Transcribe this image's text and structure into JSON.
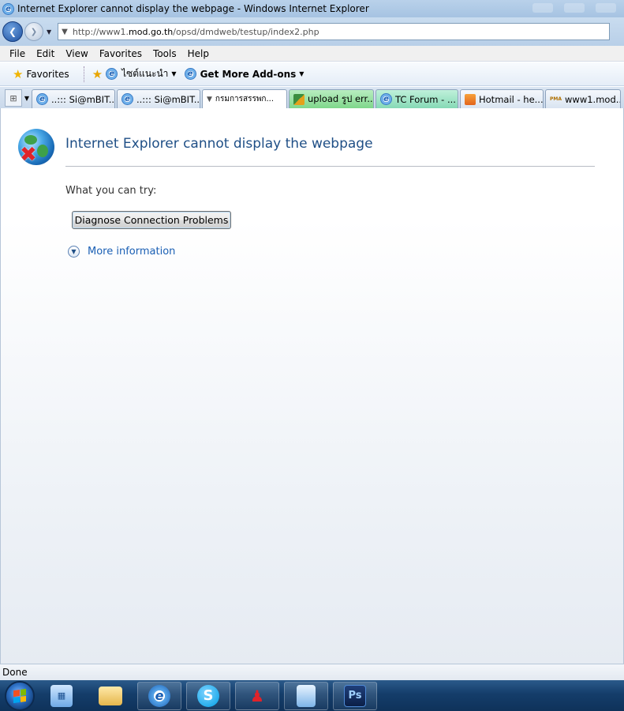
{
  "window": {
    "title": "Internet Explorer cannot display the webpage - Windows Internet Explorer"
  },
  "address": {
    "url_prefix": "http://www1.",
    "url_domain": "mod.go.th",
    "url_path": "/opsd/dmdweb/testup/index2.php"
  },
  "menu": {
    "items": [
      "File",
      "Edit",
      "View",
      "Favorites",
      "Tools",
      "Help"
    ]
  },
  "favorites_bar": {
    "favorites_label": "Favorites",
    "items": [
      {
        "label": "ไซต์แนะนำ",
        "icon": "ie-icon",
        "has_dropdown": true
      },
      {
        "label": "Get More Add-ons",
        "icon": "ie-icon",
        "has_dropdown": true,
        "bold": true
      }
    ]
  },
  "tabs": [
    {
      "label": "..::: Si@mBIT....",
      "icon": "ie-icon"
    },
    {
      "label": "..::: Si@mBIT....",
      "icon": "ie-icon"
    },
    {
      "label": "กรมการสรรพก...",
      "icon": "army-logo-icon",
      "active": true
    },
    {
      "label": "upload รูป err...",
      "icon": "puzzle-icon"
    },
    {
      "label": "TC Forum - ...",
      "icon": "ie-icon"
    },
    {
      "label": "Hotmail - he...",
      "icon": "mail-icon"
    },
    {
      "label": "www1.mod....",
      "icon": "pma-icon",
      "icon_text": "PMA"
    }
  ],
  "page": {
    "error_title": "Internet Explorer cannot display the webpage",
    "what_you_can_try": "What you can try:",
    "diagnose_button": "Diagnose Connection Problems",
    "more_information": "More information"
  },
  "status": {
    "text": "Done"
  },
  "taskbar": {
    "apps": [
      "explorer-icon",
      "folder-icon",
      "ie-icon",
      "skype-icon",
      "messenger-icon",
      "notebook-icon",
      "photoshop-icon"
    ],
    "photoshop_label": "Ps"
  },
  "colors": {
    "title_text": "#1f4f86",
    "link": "#1a5fb4",
    "taskbar": "#143d6a"
  }
}
